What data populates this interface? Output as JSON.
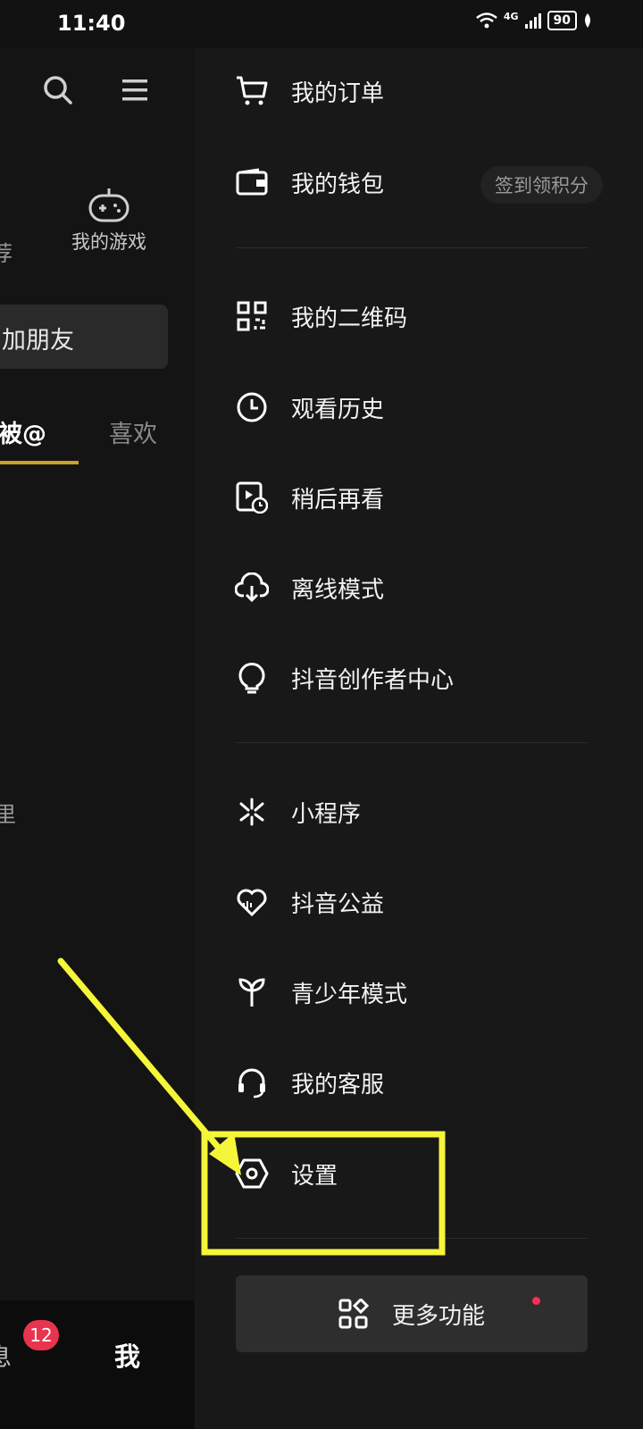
{
  "status_bar": {
    "time": "11:40",
    "network": "4G",
    "battery": "90"
  },
  "left_page": {
    "games_label": "我的游戏",
    "partial_tab_left": "荐",
    "add_friend": "加朋友",
    "tab_mention": "被@",
    "tab_like": "喜欢",
    "partial_text_mid": "里",
    "nav_messages": "息",
    "messages_badge": "12",
    "nav_me": "我"
  },
  "drawer": {
    "items": [
      {
        "label": "我的订单",
        "icon": "cart-icon"
      },
      {
        "label": "我的钱包",
        "icon": "wallet-icon"
      },
      {
        "label": "我的二维码",
        "icon": "qr-code-icon"
      },
      {
        "label": "观看历史",
        "icon": "clock-icon"
      },
      {
        "label": "稍后再看",
        "icon": "watch-later-icon"
      },
      {
        "label": "离线模式",
        "icon": "cloud-download-icon"
      },
      {
        "label": "抖音创作者中心",
        "icon": "lightbulb-icon"
      },
      {
        "label": "小程序",
        "icon": "mini-program-icon"
      },
      {
        "label": "抖音公益",
        "icon": "heart-charity-icon"
      },
      {
        "label": "青少年模式",
        "icon": "sprout-icon"
      },
      {
        "label": "我的客服",
        "icon": "headset-icon"
      },
      {
        "label": "设置",
        "icon": "settings-hexagon-icon"
      }
    ],
    "wallet_pill": "签到领积分",
    "more_button": "更多功能"
  },
  "colors": {
    "highlight": "#f5f53a",
    "badge": "#e8344e",
    "tab_underline": "#c9a227"
  }
}
